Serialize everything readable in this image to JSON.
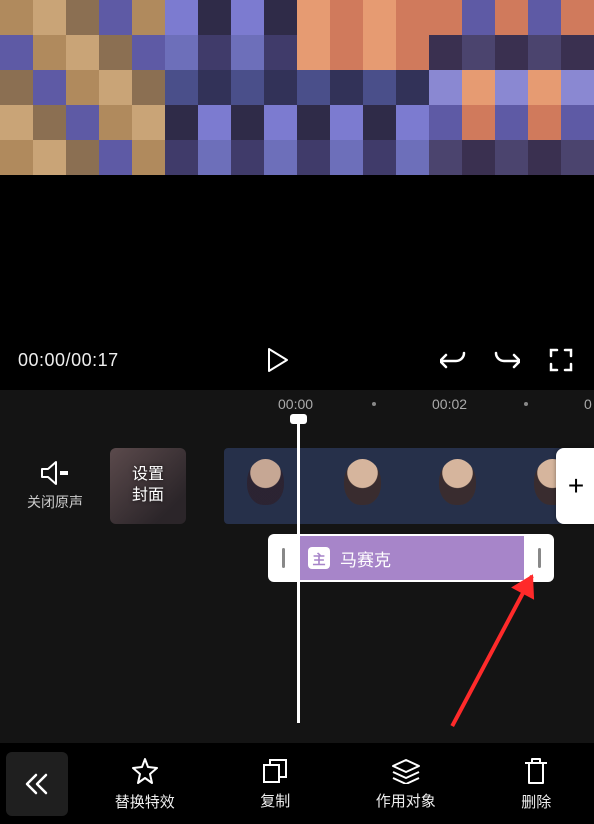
{
  "player": {
    "current_time": "00:00",
    "total_time": "00:17"
  },
  "ruler": {
    "labels": [
      "00:00",
      "00:02",
      "0"
    ]
  },
  "audio": {
    "mute_label": "关闭原声"
  },
  "cover": {
    "label_line1": "设置",
    "label_line2": "封面"
  },
  "effect": {
    "badge": "主",
    "name": "马赛克",
    "color": "#a785c9"
  },
  "toolbar": {
    "replace": "替换特效",
    "copy": "复制",
    "target": "作用对象",
    "delete": "删除"
  },
  "add_label": "+"
}
